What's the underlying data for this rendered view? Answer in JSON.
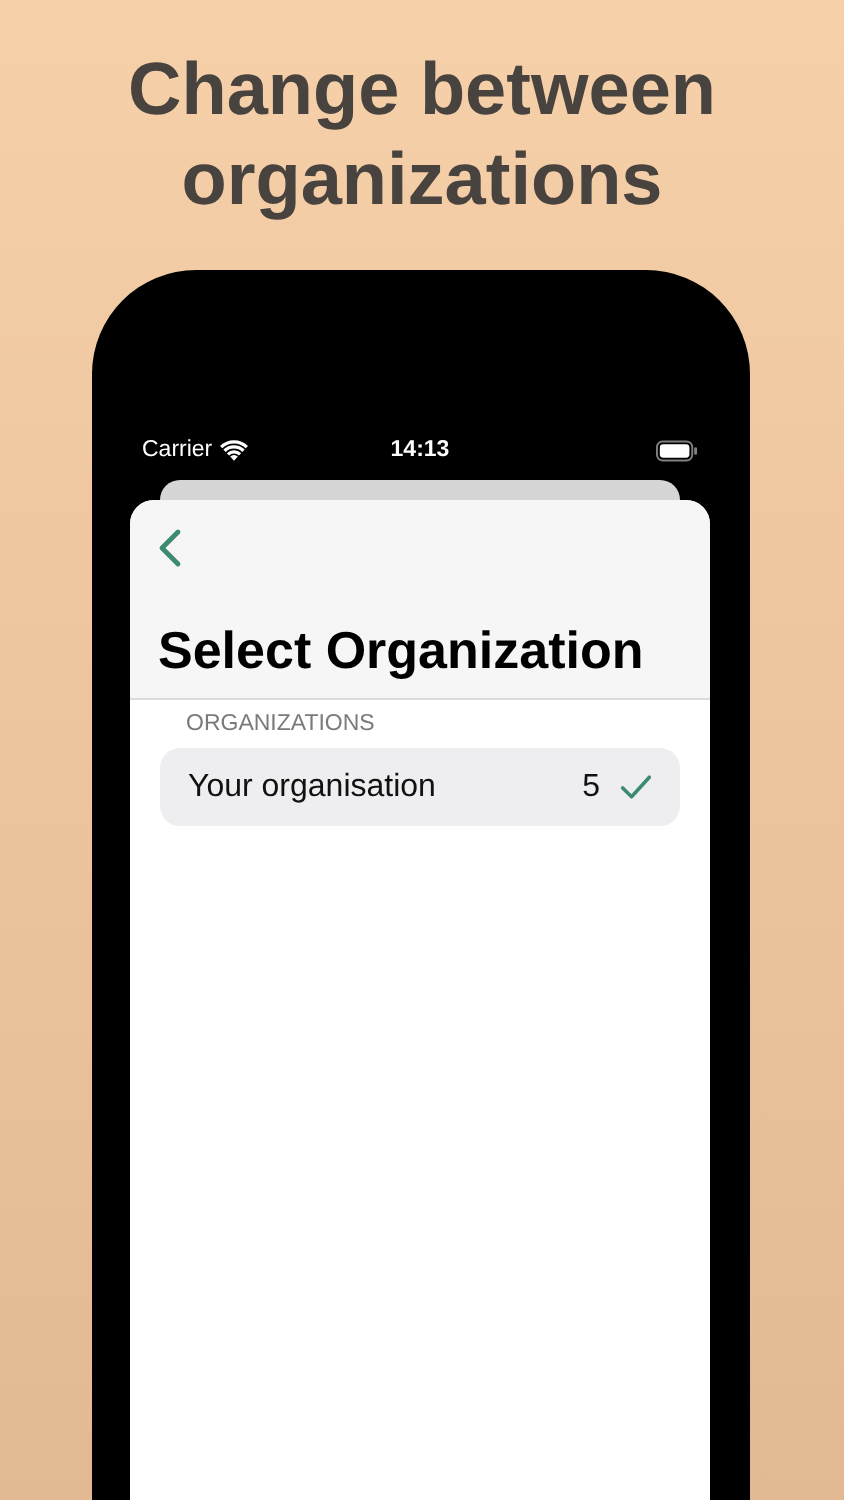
{
  "headline": "Change between organizations",
  "status_bar": {
    "carrier": "Carrier",
    "time": "14:13"
  },
  "nav": {
    "title": "Select Organization"
  },
  "section": {
    "header": "ORGANIZATIONS",
    "rows": [
      {
        "label": "Your organisation",
        "count": "5",
        "selected": true
      }
    ]
  }
}
